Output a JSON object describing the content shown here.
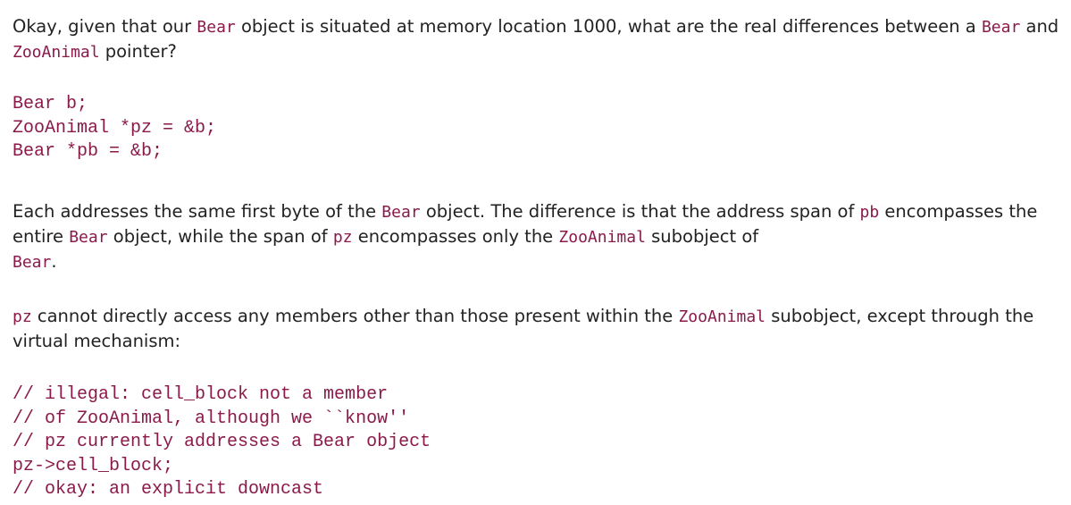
{
  "para1": {
    "t1": "Okay, given that our ",
    "c1": "Bear",
    "t2": " object is situated at memory location 1000, what are the real differences between a ",
    "c2": "Bear",
    "t3": " and ",
    "c3": "ZooAnimal",
    "t4": " pointer?"
  },
  "code1": {
    "lines": [
      "Bear b;",
      "ZooAnimal *pz = &b;",
      "Bear *pb = &b;"
    ]
  },
  "para2": {
    "t1": "Each addresses the same first byte of the ",
    "c1": "Bear",
    "t2": " object. The difference is that the address span of ",
    "c2": "pb",
    "t3": " encompasses the entire ",
    "c3": "Bear",
    "t4": " object, while the span of ",
    "c4": "pz",
    "t5": " encompasses only the ",
    "c5": "ZooAnimal",
    "t6": " subobject of ",
    "c6": "Bear",
    "t7": "."
  },
  "para3": {
    "c1": "pz",
    "t1": " cannot directly access any members other than those present within the ",
    "c2": "ZooAnimal",
    "t2": " subobject, except through the virtual mechanism:"
  },
  "code2": {
    "lines": [
      "// illegal: cell_block not a member",
      "// of ZooAnimal, although we ``know''",
      "// pz currently addresses a Bear object",
      "pz->cell_block;",
      "// okay: an explicit downcast"
    ]
  }
}
